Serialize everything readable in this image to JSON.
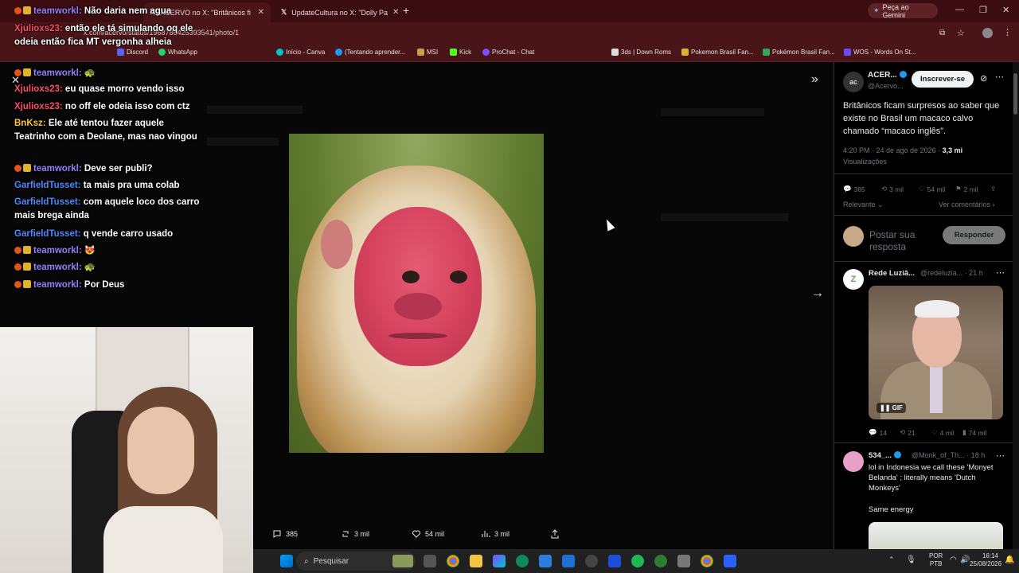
{
  "browser": {
    "tabs": [
      {
        "label": "ACERVO no X: \"Britânicos fi",
        "active": true
      },
      {
        "label": "UpdateCultura no X: \"Dolly Pa",
        "active": false
      }
    ],
    "new_tab": "+",
    "gemini_label": "Peça ao Gemini",
    "url": "x.com/acervo/status/1968786425393541/photo/1",
    "bookmarks": [
      {
        "label": "Discord",
        "color": "#5865f2"
      },
      {
        "label": "WhatsApp",
        "color": "#25d366"
      },
      {
        "label": "Início - Canva",
        "color": "#00c4cc"
      },
      {
        "label": "(Tentando aprender...",
        "color": "#1d9bf0"
      },
      {
        "label": "MSI",
        "color": "#c8a04a"
      },
      {
        "label": "Kick",
        "color": "#53fc18"
      },
      {
        "label": "ProChat - Chat",
        "color": "#7c4dff"
      },
      {
        "label": "3ds | Down Roms",
        "color": "#dddddd"
      },
      {
        "label": "Pokemon Brasil Fan...",
        "color": "#e0b32f"
      },
      {
        "label": "Pokémon Brasil Fan...",
        "color": "#34a853"
      },
      {
        "label": "WOS - Words On St...",
        "color": "#6a4cff"
      }
    ]
  },
  "chat": {
    "messages": [
      {
        "user": "teamworkl:",
        "text": "Não daria nem agua",
        "color": "#9b7dff",
        "badges": true
      },
      {
        "user": "Xjulioxs23:",
        "text": "então ele tá simulando oq ele odeia então fica MT vergonha alheia",
        "color": "#ff4d6a",
        "badges": false
      },
      {
        "user": "teamworkl:",
        "text": "🐢",
        "color": "#9b7dff",
        "badges": true
      },
      {
        "user": "Xjulioxs23:",
        "text": "eu quase morro vendo isso",
        "color": "#ff4d6a",
        "badges": false
      },
      {
        "user": "Xjulioxs23:",
        "text": "no off ele odeia isso com ctz",
        "color": "#ff4d6a",
        "badges": false
      },
      {
        "user": "BnKsz:",
        "text": "Ele até tentou fazer aquele Teatrinho com a Deolane, mas nao vingou",
        "color": "#ffc83d",
        "badges": false
      },
      {
        "user": "teamworkl:",
        "text": "Deve ser publi?",
        "color": "#9b7dff",
        "badges": true
      },
      {
        "user": "GarfieldTusset:",
        "text": "ta mais pra uma colab",
        "color": "#4d8bff",
        "badges": false
      },
      {
        "user": "GarfieldTusset:",
        "text": "com aquele loco dos carro mais brega ainda",
        "color": "#4d8bff",
        "badges": false
      },
      {
        "user": "GarfieldTusset:",
        "text": "q vende carro usado",
        "color": "#4d8bff",
        "badges": false
      },
      {
        "user": "teamworkl:",
        "text": "😻",
        "color": "#9b7dff",
        "badges": true
      },
      {
        "user": "teamworkl:",
        "text": "🐢",
        "color": "#9b7dff",
        "badges": true
      },
      {
        "user": "teamworkl:",
        "text": "Por Deus",
        "color": "#9b7dff",
        "badges": true
      }
    ]
  },
  "viewer": {
    "actions": {
      "replies": "385",
      "reposts": "3 mil",
      "likes": "54 mil",
      "views": "3 mil"
    }
  },
  "post": {
    "author_name": "ACER...",
    "author_handle": "@Acervo...",
    "follow_label": "Inscrever-se",
    "text": "Britânicos ficam surpresos ao saber que existe no Brasil um macaco calvo chamado “macaco inglês”.",
    "time": "4:20 PM · 24 de ago de 2026 · ",
    "views_count": "3,3 mi",
    "views_label": "Visualizações",
    "stats": {
      "replies": "385",
      "reposts": "3 mil",
      "likes": "54 mil",
      "bookmarks": "2 mil"
    },
    "sort_label": "Relevante",
    "see_replies": "Ver comentários",
    "reply_placeholder": "Postar sua resposta",
    "reply_button": "Responder"
  },
  "replies": [
    {
      "name": "Rede Luziâ...",
      "handle": "@redeluzia...",
      "time": "· 21 h",
      "text": "",
      "media_badge": "GIF",
      "stats": {
        "replies": "14",
        "reposts": "21",
        "likes": "4 mil",
        "views": "74 mil"
      }
    },
    {
      "name": "534_...",
      "handle": "@Monk_of_Th...",
      "time": "· 18 h",
      "text": "lol in Indonesia we call these 'Monyet Belanda' ; literally means 'Dutch Monkeys'",
      "text2": "Same energy"
    }
  ],
  "taskbar": {
    "search_placeholder": "Pesquisar",
    "lang": "POR",
    "lang2": "PTB",
    "time": "16:14",
    "date": "25/08/2026"
  }
}
